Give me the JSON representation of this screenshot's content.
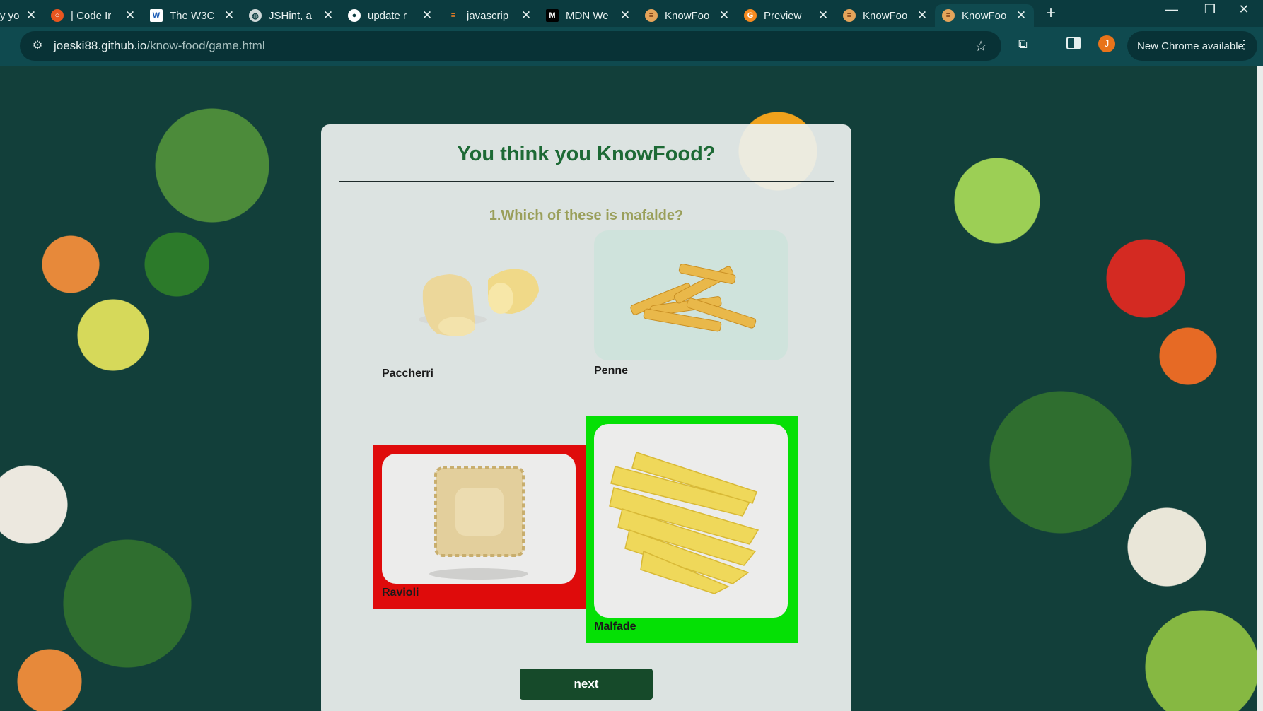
{
  "browser": {
    "tabs": [
      {
        "label": "y yo",
        "icon": ""
      },
      {
        "label": "| Code Ir",
        "icon": "codeinstitute-icon"
      },
      {
        "label": "The W3C",
        "icon": "w3c-icon"
      },
      {
        "label": "JSHint, a",
        "icon": "globe-icon"
      },
      {
        "label": "update r",
        "icon": "github-icon"
      },
      {
        "label": "javascrip",
        "icon": "stackoverflow-icon"
      },
      {
        "label": "MDN We",
        "icon": "mdn-icon"
      },
      {
        "label": "KnowFoo",
        "icon": "burger-icon"
      },
      {
        "label": "Preview",
        "icon": "gitpod-icon"
      },
      {
        "label": "KnowFoo",
        "icon": "burger-icon"
      },
      {
        "label": "KnowFoo",
        "icon": "burger-icon"
      }
    ],
    "url_host": "joeski88.github.io",
    "url_path": "/know-food/game.html",
    "avatar_initial": "J",
    "update_label": "New Chrome available"
  },
  "game": {
    "title": "You think you KnowFood?",
    "question": "1.Which of these is mafalde?",
    "options": [
      {
        "label": "Paccherri",
        "state": "neutral"
      },
      {
        "label": "Penne",
        "state": "neutral"
      },
      {
        "label": "Ravioli",
        "state": "wrong"
      },
      {
        "label": "Malfade",
        "state": "correct"
      }
    ],
    "next_label": "next",
    "colors": {
      "wrong": "#df0b0b",
      "correct": "#05e005",
      "title": "#1d6a35",
      "button": "#164a2a"
    }
  }
}
